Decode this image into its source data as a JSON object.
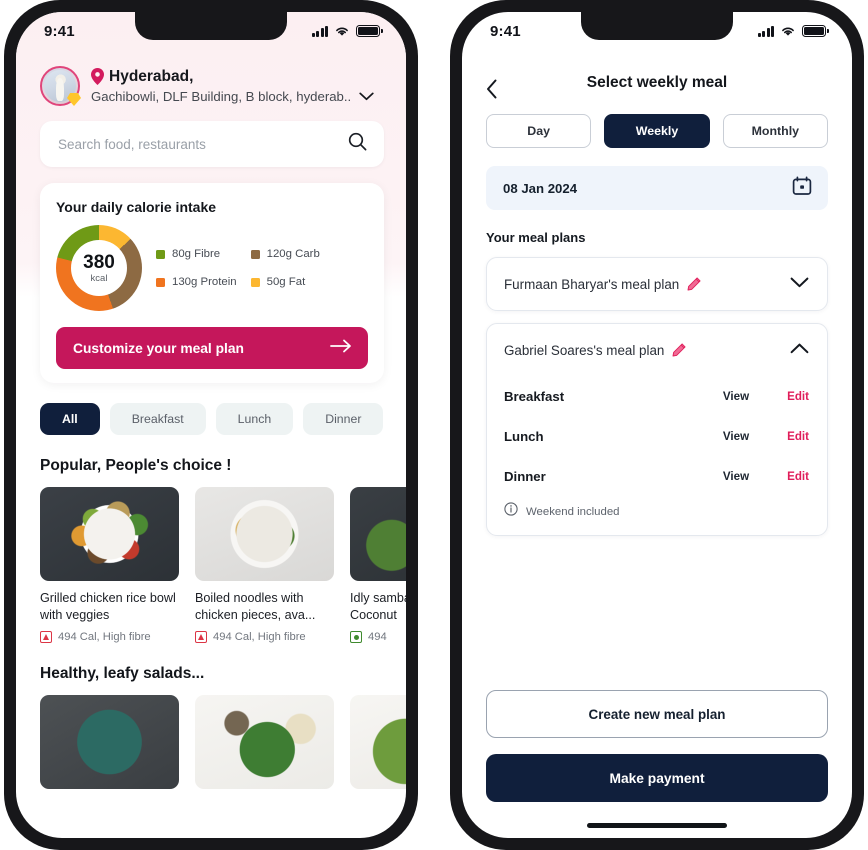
{
  "colors": {
    "brand_pink": "#c5175b",
    "accent_pink": "#e01e5a",
    "navy": "#101f3c",
    "pink_wash": "#fceff2",
    "chip_bg": "#eef3f3",
    "date_bg": "#eff4fb",
    "veg_green": "#3f8a2e",
    "nonveg_red": "#dc3545"
  },
  "left_phone": {
    "status": {
      "time": "9:41",
      "signal_icon": "cellular-signal-icon",
      "wifi_icon": "wifi-icon",
      "battery_icon": "battery-icon"
    },
    "header": {
      "avatar_name": "user-avatar",
      "badge_icon": "premium-gem-icon",
      "location_pin_icon": "location-pin-icon",
      "city": "Hyderabad,",
      "address": "Gachibowli, DLF Building, B block, hyderab..",
      "chevron_icon": "chevron-down-icon"
    },
    "search": {
      "placeholder": "Search food, restaurants",
      "value": "",
      "icon": "search-icon"
    },
    "calorie_card": {
      "title": "Your daily calorie intake",
      "total_value": "380",
      "total_unit": "kcal",
      "legend": [
        {
          "label": "80g Fibre",
          "color": "#6f9a16"
        },
        {
          "label": "120g Carb",
          "color": "#8d6a43"
        },
        {
          "label": "130g Protein",
          "color": "#f0741f"
        },
        {
          "label": "50g Fat",
          "color": "#fcb731"
        }
      ],
      "cta_label": "Customize your meal plan",
      "cta_icon": "arrow-right-icon"
    },
    "chart_data": {
      "type": "pie",
      "title": "Your daily calorie intake",
      "center_label": "380 kcal",
      "labels": [
        "Fat",
        "Carb",
        "Protein",
        "Fibre"
      ],
      "values": [
        50,
        120,
        130,
        80
      ],
      "unit": "g",
      "colors": [
        "#fcb731",
        "#8d6a43",
        "#f0741f",
        "#6f9a16"
      ],
      "legend": "right"
    },
    "filter_chips": [
      {
        "label": "All",
        "active": true
      },
      {
        "label": "Breakfast",
        "active": false
      },
      {
        "label": "Lunch",
        "active": false
      },
      {
        "label": "Dinner",
        "active": false
      }
    ],
    "sections": [
      {
        "title": "Popular, People's choice !",
        "items": [
          {
            "name": "Grilled chicken rice bowl with veggies",
            "meta": "494 Cal, High fibre",
            "diet": "nonveg"
          },
          {
            "name": "Boiled noodles with chicken pieces, ava...",
            "meta": "494 Cal, High fibre",
            "diet": "nonveg"
          },
          {
            "name": "Idly sambar with Coconut",
            "meta": "494",
            "diet": "veg"
          }
        ]
      },
      {
        "title": "Healthy, leafy salads...",
        "items": [
          {
            "name": "",
            "meta": "",
            "diet": "veg"
          },
          {
            "name": "",
            "meta": "",
            "diet": "veg"
          },
          {
            "name": "",
            "meta": "",
            "diet": "veg"
          }
        ]
      }
    ]
  },
  "right_phone": {
    "status": {
      "time": "9:41",
      "signal_icon": "cellular-signal-icon",
      "wifi_icon": "wifi-icon",
      "battery_icon": "battery-icon"
    },
    "header": {
      "back_icon": "chevron-left-icon",
      "title": "Select weekly meal"
    },
    "segments": [
      {
        "label": "Day",
        "active": false
      },
      {
        "label": "Weekly",
        "active": true
      },
      {
        "label": "Monthly",
        "active": false
      }
    ],
    "date_field": {
      "value": "08 Jan 2024",
      "icon": "calendar-icon"
    },
    "section_label": "Your meal plans",
    "plans": [
      {
        "name": "Furmaan Bharyar's meal plan",
        "edit_icon": "pencil-icon",
        "toggle_icon": "chevron-down-icon",
        "expanded": false,
        "meals": []
      },
      {
        "name": "Gabriel Soares's meal plan",
        "edit_icon": "pencil-icon",
        "toggle_icon": "chevron-up-icon",
        "expanded": true,
        "meals": [
          {
            "label": "Breakfast",
            "view": "View",
            "edit": "Edit"
          },
          {
            "label": "Lunch",
            "view": "View",
            "edit": "Edit"
          },
          {
            "label": "Dinner",
            "view": "View",
            "edit": "Edit"
          }
        ],
        "note": "Weekend included",
        "note_icon": "info-icon"
      }
    ],
    "footer": {
      "secondary_label": "Create new meal plan",
      "primary_label": "Make payment"
    }
  }
}
